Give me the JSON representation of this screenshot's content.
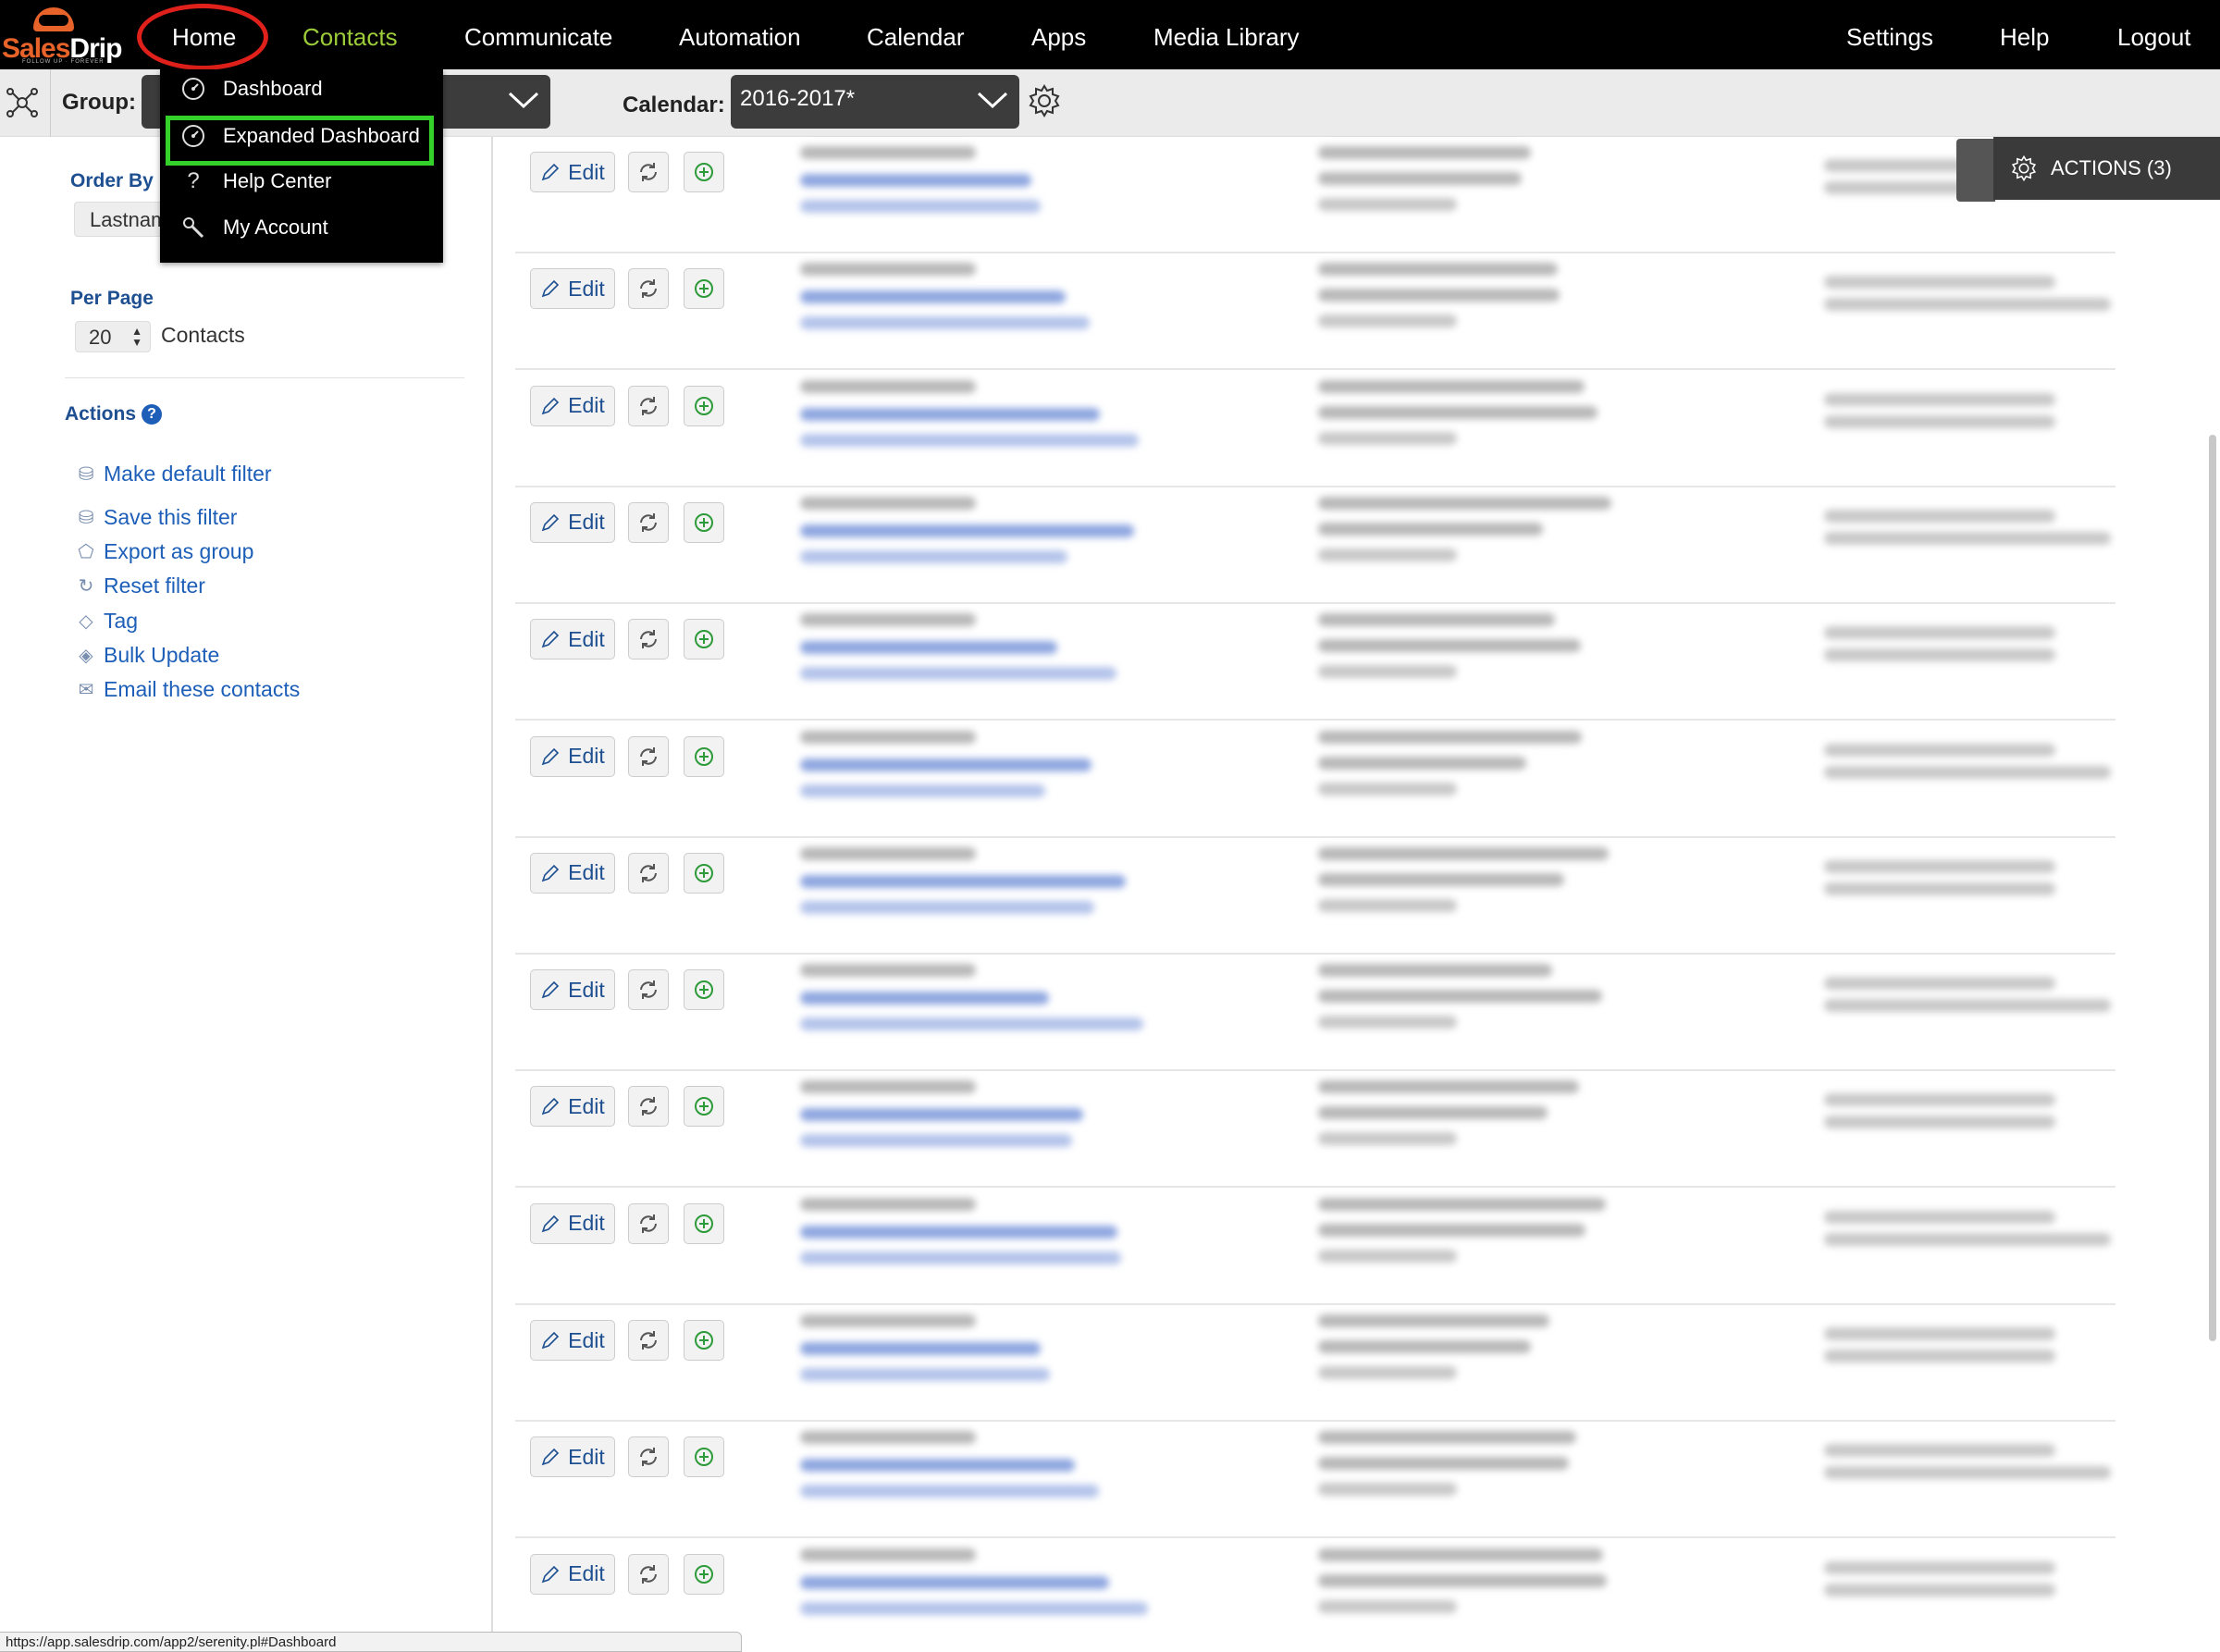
{
  "brand": {
    "logo_main": "Sales",
    "logo_accent": "Drip",
    "tagline": "FOLLOW UP · FOREVER"
  },
  "nav": {
    "items": [
      "Home",
      "Contacts",
      "Communicate",
      "Automation",
      "Calendar",
      "Apps",
      "Media Library"
    ],
    "right": [
      "Settings",
      "Help",
      "Logout"
    ],
    "active": "Contacts",
    "highlighted": "Home",
    "active_color": "#9ccc3a"
  },
  "home_menu": {
    "items": [
      {
        "label": "Dashboard",
        "icon": "speedometer-icon"
      },
      {
        "label": "Expanded Dashboard",
        "icon": "speedometer-icon",
        "highlighted": true
      },
      {
        "label": "Help Center",
        "icon": "question-icon"
      },
      {
        "label": "My Account",
        "icon": "wrench-icon"
      }
    ],
    "highlight_color": "#35d12b"
  },
  "filterbar": {
    "group_label": "Group:",
    "calendar_label": "Calendar:",
    "calendar_value": "2016-2017*"
  },
  "sidebar": {
    "order_by_label": "Order By",
    "order_by_value": "Lastname",
    "per_page_label": "Per Page",
    "per_page_value": "20",
    "per_page_suffix": "Contacts",
    "actions_label": "Actions",
    "actions": [
      {
        "label": "Make default filter",
        "icon": "stack-icon"
      },
      {
        "label": "Save this filter",
        "icon": "stack-icon"
      },
      {
        "label": "Export as group",
        "icon": "export-icon"
      },
      {
        "label": "Reset filter",
        "icon": "refresh-icon"
      },
      {
        "label": "Tag",
        "icon": "tag-icon"
      },
      {
        "label": "Bulk Update",
        "icon": "layers-icon"
      },
      {
        "label": "Email these contacts",
        "icon": "envelope-icon"
      }
    ]
  },
  "contact_list": {
    "edit_label": "Edit",
    "row_count": 13
  },
  "actions_panel": {
    "label": "ACTIONS (3)"
  },
  "status_url": "https://app.salesdrip.com/app2/serenity.pl#Dashboard",
  "colors": {
    "link": "#1d5fb8",
    "heading": "#1d4f91",
    "accent_orange": "#e8632a",
    "annotation_red": "#e0201a"
  }
}
